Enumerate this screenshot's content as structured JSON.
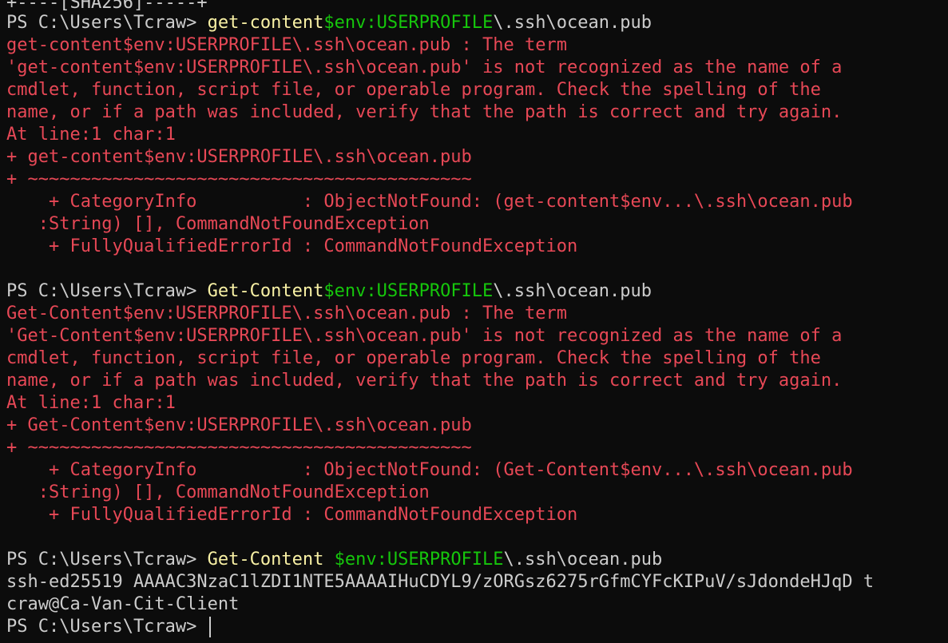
{
  "colors": {
    "background": "#0c0c0c",
    "foreground": "#cccccc",
    "command": "#f9f1a5",
    "variable": "#16c60c",
    "error": "#e74856"
  },
  "terminal": {
    "top_partial": "+----[SHA256]-----+",
    "prompt": "PS C:\\Users\\Tcraw> ",
    "block1": {
      "cmd_name": "get-content",
      "cmd_var": "$env:USERPROFILE",
      "cmd_rest": "\\.ssh\\ocean.pub",
      "errors": [
        "get-content$env:USERPROFILE\\.ssh\\ocean.pub : The term",
        "'get-content$env:USERPROFILE\\.ssh\\ocean.pub' is not recognized as the name of a",
        "cmdlet, function, script file, or operable program. Check the spelling of the",
        "name, or if a path was included, verify that the path is correct and try again.",
        "At line:1 char:1",
        "+ get-content$env:USERPROFILE\\.ssh\\ocean.pub",
        "+ ~~~~~~~~~~~~~~~~~~~~~~~~~~~~~~~~~~~~~~~~~~",
        "    + CategoryInfo          : ObjectNotFound: (get-content$env...\\.ssh\\ocean.pub",
        "   :String) [], CommandNotFoundException",
        "    + FullyQualifiedErrorId : CommandNotFoundException"
      ]
    },
    "block2": {
      "cmd_name": "Get-Content",
      "cmd_var": "$env:USERPROFILE",
      "cmd_rest": "\\.ssh\\ocean.pub",
      "errors": [
        "Get-Content$env:USERPROFILE\\.ssh\\ocean.pub : The term",
        "'Get-Content$env:USERPROFILE\\.ssh\\ocean.pub' is not recognized as the name of a",
        "cmdlet, function, script file, or operable program. Check the spelling of the",
        "name, or if a path was included, verify that the path is correct and try again.",
        "At line:1 char:1",
        "+ Get-Content$env:USERPROFILE\\.ssh\\ocean.pub",
        "+ ~~~~~~~~~~~~~~~~~~~~~~~~~~~~~~~~~~~~~~~~~~",
        "    + CategoryInfo          : ObjectNotFound: (Get-Content$env...\\.ssh\\ocean.pub",
        "   :String) [], CommandNotFoundException",
        "    + FullyQualifiedErrorId : CommandNotFoundException"
      ]
    },
    "block3": {
      "cmd_name": "Get-Content",
      "cmd_var": " $env:USERPROFILE",
      "cmd_rest": "\\.ssh\\ocean.pub",
      "output": [
        "ssh-ed25519 AAAAC3NzaC1lZDI1NTE5AAAAIHuCDYL9/zORGsz6275rGfmCYFcKIPuV/sJdondeHJqD t",
        "craw@Ca-Van-Cit-Client"
      ]
    }
  }
}
